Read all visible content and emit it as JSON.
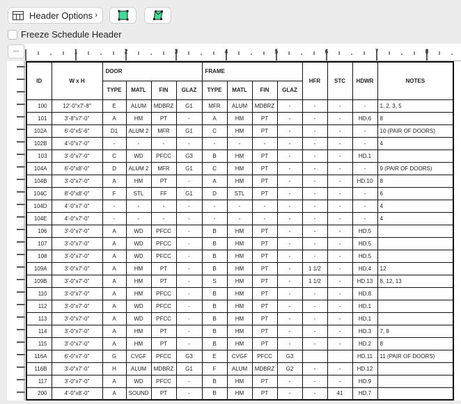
{
  "toolbar": {
    "header_options_label": "Header Options",
    "freeze_label": "Freeze Schedule Header",
    "more_label": "...",
    "accent": "#3ddc97"
  },
  "ruler": {
    "labels": [
      "1",
      "2",
      "3",
      "4",
      "5",
      "6",
      "7",
      "8"
    ]
  },
  "table": {
    "groups": {
      "door": "DOOR",
      "frame": "FRAME"
    },
    "headers": {
      "id": "ID",
      "wxh": "W x H",
      "hfr": "HFR",
      "stc": "STC",
      "hdwr": "HDWR",
      "notes": "NOTES"
    },
    "sub_headers": [
      "TYPE",
      "MATL",
      "FIN",
      "GLAZ",
      "TYPE",
      "MATL",
      "FIN",
      "GLAZ"
    ],
    "rows": [
      [
        "100",
        "12'-0\"x7'-8\"",
        "E",
        "ALUM",
        "MDBRZ",
        "G1",
        "MFR",
        "ALUM",
        "MDBRZ",
        "-",
        "-",
        "-",
        "-",
        "1, 2, 3, 5"
      ],
      [
        "101",
        "3'-8\"x7'-0\"",
        "A",
        "HM",
        "PT",
        "-",
        "A",
        "HM",
        "PT",
        "-",
        "-",
        "-",
        "HD.6",
        "8"
      ],
      [
        "102A",
        "6'-0\"x5'-6\"",
        "D1",
        "ALUM 2",
        "MFR",
        "G1",
        "C",
        "HM",
        "PT",
        "-",
        "-",
        "-",
        "-",
        "10 (PAIR OF DOORS)"
      ],
      [
        "102B",
        "4'-0\"x7'-0\"",
        "-",
        "-",
        "-",
        "-",
        "-",
        "-",
        "-",
        "-",
        "-",
        "-",
        "-",
        "4"
      ],
      [
        "103",
        "3'-0\"x7'-0\"",
        "C",
        "WD",
        "PFCC",
        "G3",
        "B",
        "HM",
        "PT",
        "-",
        "-",
        "-",
        "HD.1",
        ""
      ],
      [
        "104A",
        "6'-0\"x8'-0\"",
        "D",
        "ALUM 2",
        "MFR",
        "G1",
        "C",
        "HM",
        "PT",
        "-",
        "-",
        "-",
        "-",
        "9 (PAIR OF DOORS)"
      ],
      [
        "104B",
        "3'-0\"x7'-0\"",
        "A",
        "HM",
        "PT",
        "-",
        "A",
        "HM",
        "PT",
        "-",
        "-",
        "-",
        "HD.10",
        "8"
      ],
      [
        "104C",
        "8'-0\"x8'-0\"",
        "F",
        "STL",
        "FF",
        "G1",
        "D",
        "STL",
        "PT",
        "-",
        "-",
        "-",
        "-",
        "6"
      ],
      [
        "104D",
        "4'-0\"x7'-0\"",
        "-",
        "-",
        "-",
        "-",
        "-",
        "-",
        "-",
        "-",
        "-",
        "-",
        "-",
        "4"
      ],
      [
        "104E",
        "4'-0\"x7'-0\"",
        "-",
        "-",
        "-",
        "-",
        "-",
        "-",
        "-",
        "-",
        "-",
        "-",
        "-",
        "4"
      ],
      [
        "106",
        "3'-0\"x7'-0\"",
        "A",
        "WD",
        "PFCC",
        "-",
        "B",
        "HM",
        "PT",
        "-",
        "-",
        "-",
        "HD.5",
        ""
      ],
      [
        "107",
        "3'-0\"x7'-0\"",
        "A",
        "WD",
        "PFCC",
        "-",
        "B",
        "HM",
        "PT",
        "-",
        "-",
        "-",
        "HD.5",
        ""
      ],
      [
        "108",
        "3'-0\"x7'-0\"",
        "A",
        "WD",
        "PFCC",
        "-",
        "B",
        "HM",
        "PT",
        "-",
        "-",
        "-",
        "HD.5",
        ""
      ],
      [
        "109A",
        "3'-0\"x7'-0\"",
        "A",
        "HM",
        "PT",
        "-",
        "B",
        "HM",
        "PT",
        "-",
        "1 1/2",
        "-",
        "HD.4",
        "12"
      ],
      [
        "109B",
        "3'-0\"x7'-0\"",
        "A",
        "HM",
        "PT",
        "-",
        "S",
        "HM",
        "PT",
        "-",
        "1 1/2",
        "-",
        "HD.13",
        "8, 12, 13"
      ],
      [
        "110",
        "3'-0\"x7'-0\"",
        "A",
        "HM",
        "PFCC",
        "-",
        "B",
        "HM",
        "PT",
        "-",
        "-",
        "-",
        "HD.8",
        ""
      ],
      [
        "112",
        "3'-0\"x7'-0\"",
        "A",
        "WD",
        "PFCC",
        "-",
        "B",
        "HM",
        "PT",
        "-",
        "-",
        "-",
        "HD.1",
        ""
      ],
      [
        "113",
        "3'-0\"x7'-0\"",
        "A",
        "WD",
        "PFCC",
        "-",
        "B",
        "HM",
        "PT",
        "-",
        "-",
        "-",
        "HD.1",
        ""
      ],
      [
        "114",
        "3'-0\"x7'-0\"",
        "A",
        "HM",
        "PT",
        "-",
        "B",
        "HM",
        "PT",
        "-",
        "-",
        "-",
        "HD.3",
        "7, 8"
      ],
      [
        "115",
        "3'-0\"x7'-0\"",
        "A",
        "HM",
        "PT",
        "-",
        "B",
        "HM",
        "PT",
        "-",
        "-",
        "-",
        "HD.2",
        "8"
      ],
      [
        "116A",
        "6'-0\"x7'-0\"",
        "G",
        "CVGF",
        "PFCC",
        "G3",
        "E",
        "CVGF",
        "PFCC",
        "G3",
        "",
        "",
        "HD.11",
        "11 (PAIR OF DOORS)"
      ],
      [
        "116B",
        "3'-0\"x7'-0\"",
        "H",
        "ALUM",
        "MDBRZ",
        "G1",
        "F",
        "ALUM",
        "MDBRZ",
        "G2",
        "-",
        "-",
        "HD.12",
        ""
      ],
      [
        "117",
        "3'-0\"x7'-0\"",
        "A",
        "WD",
        "PFCC",
        "-",
        "B",
        "HM",
        "PT",
        "-",
        "-",
        "-",
        "HD.9",
        ""
      ],
      [
        "200",
        "4'-0\"x8'-0\"",
        "A",
        "SOUND",
        "PT",
        "-",
        "B",
        "HM",
        "PT",
        "-",
        "-",
        "41",
        "HD.7",
        ""
      ]
    ]
  }
}
